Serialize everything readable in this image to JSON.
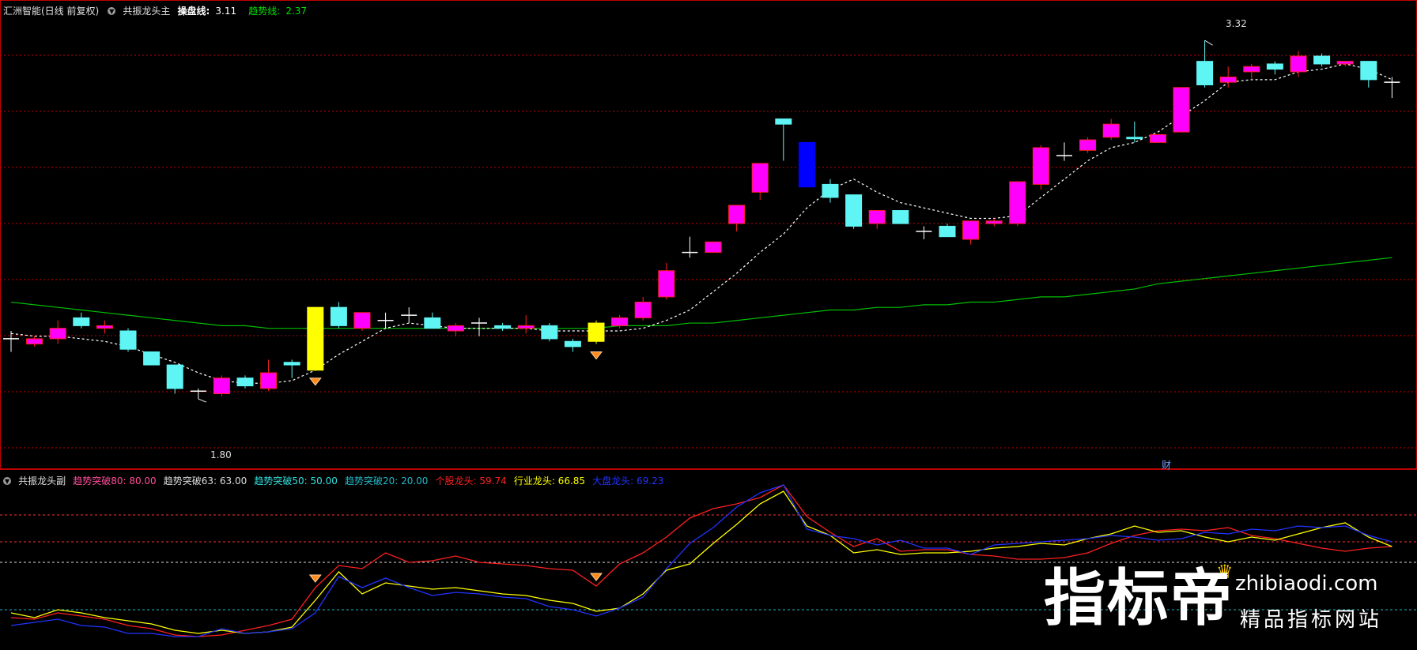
{
  "main_header": {
    "stock": "汇洲智能(日线 前复权)",
    "indicator": "共振龙头主",
    "op_label": "操盘线:",
    "op_value": "3.11",
    "trend_label": "趋势线:",
    "trend_value": "2.37"
  },
  "sub_header": {
    "indicator": "共振龙头副",
    "items": [
      {
        "text": "趋势突破80: 80.00",
        "color": "#ff4d9a"
      },
      {
        "text": "趋势突破63: 63.00",
        "color": "#dddddd"
      },
      {
        "text": "趋势突破50: 50.00",
        "color": "#33e0e0"
      },
      {
        "text": "趋势突破20: 20.00",
        "color": "#22b8c8"
      },
      {
        "text": "个股龙头: 59.74",
        "color": "#ff2020"
      },
      {
        "text": "行业龙头: 66.85",
        "color": "#ffff00"
      },
      {
        "text": "大盘龙头: 69.23",
        "color": "#2233ff"
      }
    ]
  },
  "price_labels": {
    "high": "3.32",
    "low": "1.80",
    "cai": "财"
  },
  "colors": {
    "up": "#ff00ff",
    "down": "#5ff5f5",
    "signal": "#ffff00",
    "bigdown": "#0000ff",
    "ma": "#00c000",
    "op": "#ffffff",
    "grid": "#c00000"
  },
  "icons": {
    "collapse": "chevron-down-icon",
    "signal": "diamond-icon",
    "peak": "arrow-icon"
  },
  "watermark": {
    "brand": "指标帝",
    "url": "zhibiaodi.com",
    "tagline": "精品指标网站"
  },
  "chart_data": {
    "type": "candlestick",
    "price_axis_range": [
      1.7,
      3.42
    ],
    "candles": [
      {
        "o": 2.18,
        "h": 2.21,
        "l": 2.13,
        "c": 2.18,
        "s": "doji"
      },
      {
        "o": 2.16,
        "h": 2.19,
        "l": 2.15,
        "c": 2.18,
        "s": "up"
      },
      {
        "o": 2.18,
        "h": 2.25,
        "l": 2.16,
        "c": 2.22,
        "s": "up"
      },
      {
        "o": 2.26,
        "h": 2.28,
        "l": 2.22,
        "c": 2.23,
        "s": "down"
      },
      {
        "o": 2.22,
        "h": 2.25,
        "l": 2.2,
        "c": 2.23,
        "s": "up"
      },
      {
        "o": 2.21,
        "h": 2.22,
        "l": 2.13,
        "c": 2.14,
        "s": "down"
      },
      {
        "o": 2.13,
        "h": 2.13,
        "l": 2.08,
        "c": 2.08,
        "s": "down"
      },
      {
        "o": 2.08,
        "h": 2.08,
        "l": 1.97,
        "c": 1.99,
        "s": "down"
      },
      {
        "o": 1.98,
        "h": 1.99,
        "l": 1.95,
        "c": 1.98,
        "s": "doji"
      },
      {
        "o": 1.97,
        "h": 2.04,
        "l": 1.96,
        "c": 2.03,
        "s": "up"
      },
      {
        "o": 2.03,
        "h": 2.04,
        "l": 1.99,
        "c": 2.0,
        "s": "down"
      },
      {
        "o": 1.99,
        "h": 2.1,
        "l": 1.98,
        "c": 2.05,
        "s": "up"
      },
      {
        "o": 2.08,
        "h": 2.1,
        "l": 2.03,
        "c": 2.09,
        "s": "down"
      },
      {
        "o": 2.06,
        "h": 2.3,
        "l": 2.06,
        "c": 2.3,
        "s": "signal"
      },
      {
        "o": 2.3,
        "h": 2.32,
        "l": 2.22,
        "c": 2.23,
        "s": "down"
      },
      {
        "o": 2.22,
        "h": 2.28,
        "l": 2.21,
        "c": 2.28,
        "s": "up"
      },
      {
        "o": 2.25,
        "h": 2.28,
        "l": 2.22,
        "c": 2.25,
        "s": "doji"
      },
      {
        "o": 2.27,
        "h": 2.3,
        "l": 2.24,
        "c": 2.27,
        "s": "doji"
      },
      {
        "o": 2.26,
        "h": 2.28,
        "l": 2.22,
        "c": 2.22,
        "s": "down"
      },
      {
        "o": 2.21,
        "h": 2.24,
        "l": 2.19,
        "c": 2.23,
        "s": "up"
      },
      {
        "o": 2.24,
        "h": 2.26,
        "l": 2.19,
        "c": 2.23,
        "s": "doji"
      },
      {
        "o": 2.23,
        "h": 2.24,
        "l": 2.21,
        "c": 2.22,
        "s": "down"
      },
      {
        "o": 2.22,
        "h": 2.27,
        "l": 2.2,
        "c": 2.23,
        "s": "up"
      },
      {
        "o": 2.23,
        "h": 2.24,
        "l": 2.17,
        "c": 2.18,
        "s": "down"
      },
      {
        "o": 2.17,
        "h": 2.18,
        "l": 2.13,
        "c": 2.15,
        "s": "down"
      },
      {
        "o": 2.17,
        "h": 2.25,
        "l": 2.16,
        "c": 2.24,
        "s": "signal"
      },
      {
        "o": 2.23,
        "h": 2.27,
        "l": 2.22,
        "c": 2.26,
        "s": "up"
      },
      {
        "o": 2.26,
        "h": 2.34,
        "l": 2.25,
        "c": 2.32,
        "s": "up"
      },
      {
        "o": 2.34,
        "h": 2.47,
        "l": 2.33,
        "c": 2.44,
        "s": "up"
      },
      {
        "o": 2.5,
        "h": 2.57,
        "l": 2.49,
        "c": 2.51,
        "s": "doji"
      },
      {
        "o": 2.51,
        "h": 2.55,
        "l": 2.51,
        "c": 2.55,
        "s": "up"
      },
      {
        "o": 2.62,
        "h": 2.67,
        "l": 2.59,
        "c": 2.69,
        "s": "up"
      },
      {
        "o": 2.74,
        "h": 2.85,
        "l": 2.71,
        "c": 2.85,
        "s": "up"
      },
      {
        "o": 3.02,
        "h": 3.02,
        "l": 2.86,
        "c": 3.0,
        "s": "down"
      },
      {
        "o": 2.93,
        "h": 2.93,
        "l": 2.76,
        "c": 2.76,
        "s": "bigdown"
      },
      {
        "o": 2.77,
        "h": 2.79,
        "l": 2.7,
        "c": 2.72,
        "s": "down"
      },
      {
        "o": 2.73,
        "h": 2.73,
        "l": 2.6,
        "c": 2.61,
        "s": "down"
      },
      {
        "o": 2.62,
        "h": 2.67,
        "l": 2.6,
        "c": 2.67,
        "s": "up"
      },
      {
        "o": 2.67,
        "h": 2.67,
        "l": 2.62,
        "c": 2.62,
        "s": "down"
      },
      {
        "o": 2.59,
        "h": 2.61,
        "l": 2.56,
        "c": 2.58,
        "s": "doji"
      },
      {
        "o": 2.57,
        "h": 2.62,
        "l": 2.57,
        "c": 2.61,
        "s": "down"
      },
      {
        "o": 2.56,
        "h": 2.63,
        "l": 2.54,
        "c": 2.63,
        "s": "up"
      },
      {
        "o": 2.62,
        "h": 2.64,
        "l": 2.61,
        "c": 2.63,
        "s": "up"
      },
      {
        "o": 2.62,
        "h": 2.78,
        "l": 2.61,
        "c": 2.78,
        "s": "up"
      },
      {
        "o": 2.77,
        "h": 2.92,
        "l": 2.75,
        "c": 2.91,
        "s": "up"
      },
      {
        "o": 2.88,
        "h": 2.93,
        "l": 2.86,
        "c": 2.88,
        "s": "doji"
      },
      {
        "o": 2.9,
        "h": 2.95,
        "l": 2.89,
        "c": 2.94,
        "s": "up"
      },
      {
        "o": 2.95,
        "h": 3.02,
        "l": 2.94,
        "c": 3.0,
        "s": "up"
      },
      {
        "o": 2.95,
        "h": 3.01,
        "l": 2.93,
        "c": 2.95,
        "s": "down"
      },
      {
        "o": 2.93,
        "h": 2.96,
        "l": 2.93,
        "c": 2.96,
        "s": "up"
      },
      {
        "o": 2.97,
        "h": 3.14,
        "l": 2.97,
        "c": 3.14,
        "s": "up"
      },
      {
        "o": 3.24,
        "h": 3.32,
        "l": 3.14,
        "c": 3.15,
        "s": "down"
      },
      {
        "o": 3.16,
        "h": 3.22,
        "l": 3.14,
        "c": 3.18,
        "s": "up"
      },
      {
        "o": 3.2,
        "h": 3.23,
        "l": 3.17,
        "c": 3.22,
        "s": "up"
      },
      {
        "o": 3.21,
        "h": 3.24,
        "l": 3.19,
        "c": 3.23,
        "s": "down"
      },
      {
        "o": 3.2,
        "h": 3.28,
        "l": 3.18,
        "c": 3.26,
        "s": "up"
      },
      {
        "o": 3.26,
        "h": 3.27,
        "l": 3.22,
        "c": 3.23,
        "s": "down"
      },
      {
        "o": 3.24,
        "h": 3.24,
        "l": 3.22,
        "c": 3.23,
        "s": "up"
      },
      {
        "o": 3.24,
        "h": 3.24,
        "l": 3.14,
        "c": 3.17,
        "s": "down"
      },
      {
        "o": 3.16,
        "h": 3.18,
        "l": 3.1,
        "c": 3.16,
        "s": "doji"
      }
    ],
    "op_line": [
      2.2,
      2.19,
      2.19,
      2.18,
      2.17,
      2.15,
      2.12,
      2.09,
      2.05,
      2.02,
      2.01,
      2.01,
      2.02,
      2.06,
      2.12,
      2.17,
      2.22,
      2.24,
      2.23,
      2.22,
      2.22,
      2.22,
      2.22,
      2.21,
      2.21,
      2.21,
      2.21,
      2.22,
      2.25,
      2.29,
      2.36,
      2.43,
      2.51,
      2.58,
      2.68,
      2.75,
      2.79,
      2.74,
      2.7,
      2.68,
      2.66,
      2.64,
      2.64,
      2.65,
      2.72,
      2.79,
      2.86,
      2.91,
      2.93,
      2.97,
      3.03,
      3.09,
      3.16,
      3.17,
      3.17,
      3.2,
      3.21,
      3.23,
      3.21,
      3.17
    ],
    "trend_line": [
      2.32,
      2.31,
      2.3,
      2.29,
      2.28,
      2.27,
      2.26,
      2.25,
      2.24,
      2.23,
      2.23,
      2.22,
      2.22,
      2.22,
      2.22,
      2.22,
      2.22,
      2.22,
      2.22,
      2.22,
      2.22,
      2.22,
      2.22,
      2.22,
      2.22,
      2.22,
      2.23,
      2.23,
      2.23,
      2.24,
      2.24,
      2.25,
      2.26,
      2.27,
      2.28,
      2.29,
      2.29,
      2.3,
      2.3,
      2.31,
      2.31,
      2.32,
      2.32,
      2.33,
      2.34,
      2.34,
      2.35,
      2.36,
      2.37,
      2.39,
      2.4,
      2.41,
      2.42,
      2.43,
      2.44,
      2.45,
      2.46,
      2.47,
      2.48,
      2.49
    ],
    "signal_bars": [
      13,
      25
    ],
    "thresholds": [
      80,
      63,
      50,
      20
    ],
    "sub_range": [
      0,
      100
    ],
    "sub_series": [
      {
        "name": "个股龙头",
        "color": "#ff2020",
        "values": [
          15,
          14,
          18,
          16,
          14,
          10,
          8,
          4,
          3,
          4,
          7,
          10,
          14,
          34,
          48,
          46,
          56,
          50,
          51,
          54,
          50,
          49,
          48,
          46,
          45,
          35,
          49,
          56,
          66,
          78,
          84,
          87,
          91,
          99,
          79,
          69,
          60,
          65,
          57,
          58,
          58,
          55,
          54,
          52,
          52,
          53,
          56,
          62,
          67,
          70,
          71,
          70,
          72,
          67,
          65,
          62,
          59,
          57,
          59,
          60
        ]
      },
      {
        "name": "行业龙头",
        "color": "#ffff00",
        "values": [
          18,
          15,
          20,
          18,
          15,
          13,
          11,
          7,
          5,
          7,
          5,
          6,
          9,
          26,
          44,
          30,
          37,
          35,
          33,
          34,
          32,
          30,
          29,
          26,
          24,
          19,
          21,
          30,
          45,
          49,
          62,
          74,
          87,
          95,
          73,
          67,
          56,
          58,
          55,
          56,
          56,
          57,
          59,
          60,
          62,
          61,
          65,
          68,
          73,
          69,
          70,
          66,
          63,
          66,
          64,
          68,
          72,
          75,
          66,
          60
        ]
      },
      {
        "name": "大盘龙头",
        "color": "#2233ff",
        "values": [
          10,
          12,
          14,
          10,
          9,
          5,
          5,
          3,
          3,
          8,
          5,
          6,
          8,
          18,
          41,
          34,
          40,
          34,
          29,
          31,
          30,
          28,
          27,
          22,
          20,
          16,
          21,
          28,
          46,
          62,
          72,
          85,
          94,
          99,
          71,
          67,
          65,
          61,
          64,
          59,
          59,
          55,
          61,
          62,
          63,
          64,
          65,
          67,
          66,
          64,
          65,
          69,
          68,
          71,
          70,
          73,
          72,
          73,
          67,
          63
        ]
      }
    ]
  }
}
